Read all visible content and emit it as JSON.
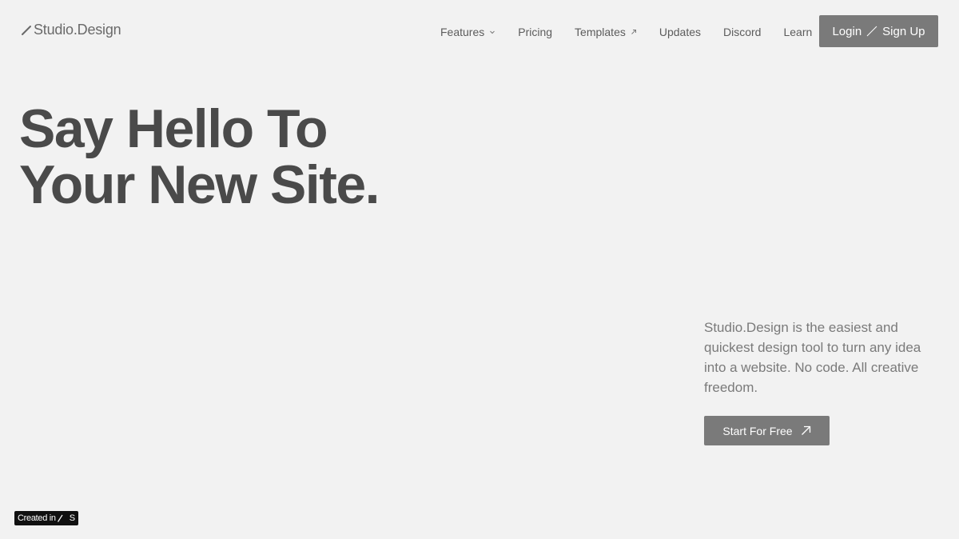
{
  "header": {
    "logo_text": "Studio.Design",
    "nav": [
      {
        "label": "Features",
        "icon": "chevron-down-icon"
      },
      {
        "label": "Pricing"
      },
      {
        "label": "Templates",
        "icon": "arrow-up-right-icon"
      },
      {
        "label": "Updates"
      },
      {
        "label": "Discord"
      },
      {
        "label": "Learn"
      }
    ],
    "login_label": "Login",
    "signup_label": "Sign Up"
  },
  "hero": {
    "title_line1": "Say Hello To",
    "title_line2": "Your New Site.",
    "description": "Studio.Design is the easiest and quickest design tool to turn any idea into a website. No code. All creative freedom.",
    "cta_label": "Start For Free",
    "cta_icon": "arrow-up-right-icon"
  },
  "badge": {
    "label": "Created in",
    "mark": "S"
  },
  "colors": {
    "background": "#f2f2f2",
    "button": "#7a7a7a",
    "heading": "#4a4a4a",
    "badge": "#111111"
  }
}
